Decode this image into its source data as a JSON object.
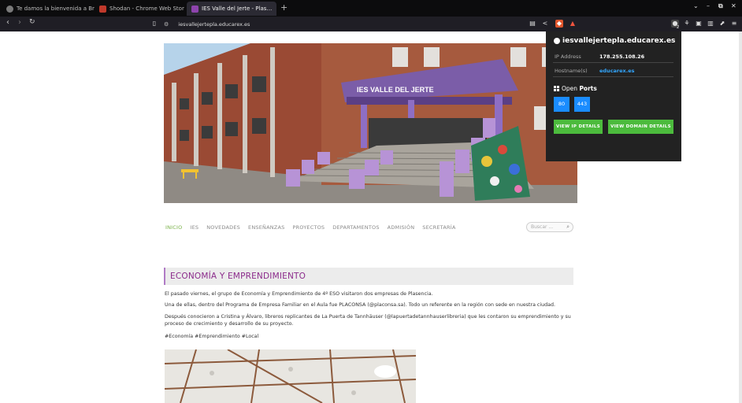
{
  "tabs": [
    {
      "title": "Te damos la bienvenida a Br…",
      "active": false
    },
    {
      "title": "Shodan - Chrome Web Store",
      "active": false
    },
    {
      "title": "IES Valle del Jerte - Plas…",
      "active": true
    }
  ],
  "toolbar": {
    "url": "iesvallejertepla.educarex.es"
  },
  "menu": [
    "INICIO",
    "IES",
    "NOVEDADES",
    "ENSEÑANZAS",
    "PROYECTOS",
    "DEPARTAMENTOS",
    "ADMISIÓN",
    "SECRETARÍA"
  ],
  "search": {
    "placeholder": "Buscar ..."
  },
  "hero": {
    "sign": "IES VALLE DEL JERTE"
  },
  "article": {
    "title": "ECONOMÍA Y EMPRENDIMIENTO",
    "p1": "El pasado viernes, el grupo de Economía y Emprendimiento de 4º ESO visitaron dos empresas de Plasencia.",
    "p2": "Una de ellas, dentro del Programa de Empresa Familiar en el Aula fue PLACONSA (@placonsa.sa). Todo un referente en la región con sede en nuestra ciudad.",
    "p3": "Después conocieron a Cristina y Álvaro, libreros replicantes de La Puerta de Tannhäuser (@lapuertadetannhauserlibreria) que les contaron su emprendimiento y su proceso de crecimiento y desarrollo de su proyecto.",
    "p4": "#Economía #Emprendimiento #Local"
  },
  "popup": {
    "host": "iesvallejertepla.educarex.es",
    "ip_label": "IP Address",
    "ip": "178.255.108.26",
    "hostnames_label": "Hostname(s)",
    "hostname": "educarex.es",
    "open": "Open ",
    "ports_word": "Ports",
    "ports": [
      "80",
      "443"
    ],
    "btn_ip": "VIEW IP DETAILS",
    "btn_domain": "VIEW DOMAIN DETAILS"
  },
  "badge": "2"
}
